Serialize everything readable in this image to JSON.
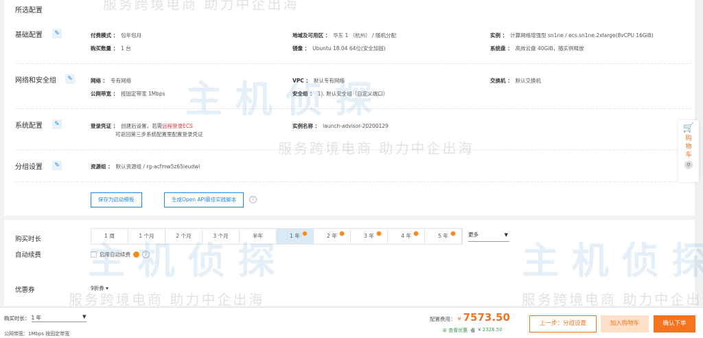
{
  "title": "所选配置",
  "watermark": {
    "logo": "主机侦探",
    "slogan": "服务跨境电商 助力中企出海"
  },
  "sections": {
    "basic": {
      "name": "基础配置",
      "pay_k": "付费模式 ：",
      "pay_v": "包年包月",
      "qty_k": "购买数量 ：",
      "qty_v": "1 台",
      "region_k": "地域及可用区 ：",
      "region_v": "华东 1 （杭州） / 随机分配",
      "image_k": "镜像 ：",
      "image_v": "Ubuntu 18.04 64位(安全加固)",
      "inst_k": "实例 ：",
      "inst_v": "计算网络增强型 sn1ne / ecs.sn1ne.2xlarge(8vCPU 16GiB)",
      "disk_k": "系统盘 ：",
      "disk_v": "高效云盘 40GiB，随实例释放"
    },
    "network": {
      "name": "网络和安全组",
      "net_k": "网络 ：",
      "net_v": "专有网络",
      "bw_k": "公网带宽 ：",
      "bw_v": "按固定带宽 1Mbps",
      "vpc_k": "VPC ：",
      "vpc_v": "默认专有网络",
      "sg_k": "安全组 ：",
      "sg_v": "1). 默认安全组（自定义端口）",
      "sw_k": "交换机 ：",
      "sw_v": "默认交换机"
    },
    "system": {
      "name": "系统配置",
      "login_k": "登录凭证 ：",
      "login_v1": "创建后设置，若需",
      "login_link": "远程登录ECS",
      "login_v2": "可返回第三步系统配置里配置登录凭证",
      "iname_k": "实例名称 ：",
      "iname_v": "launch-advisor-20200129"
    },
    "group": {
      "name": "分组设置",
      "rg_k": "资源组 ：",
      "rg_v": "默认资源组 / rg-acfmw5z65ieudwi"
    }
  },
  "actions": {
    "save_template": "保存为启动模板",
    "gen_openapi": "生成Open API最佳实践脚本",
    "help": "?"
  },
  "purchase": {
    "duration_label": "购买时长",
    "durations": [
      {
        "label": "1 周"
      },
      {
        "label": "1 个月"
      },
      {
        "label": "2 个月"
      },
      {
        "label": "3 个月"
      },
      {
        "label": "半年"
      },
      {
        "label": "1 年",
        "selected": true,
        "discount": true
      },
      {
        "label": "2 年",
        "discount": true
      },
      {
        "label": "3 年",
        "discount": true
      },
      {
        "label": "4 年",
        "discount": true
      },
      {
        "label": "5 年",
        "discount": true
      }
    ],
    "more": "更多",
    "auto_label": "自动续费",
    "auto_checkbox": "启用自动续费",
    "auto_checked": false,
    "coupon_label": "优惠券",
    "coupon_value": "9折券"
  },
  "cart": {
    "label": "购物车",
    "count": "0"
  },
  "footer": {
    "duration_k": "购买时长：",
    "duration_v": "1 年",
    "bw": "公网带宽：1Mbps 按固定带宽",
    "cost_k": "配置费用：",
    "currency": "¥",
    "cost": "7573.50",
    "discount_link": "查看优惠",
    "save_k": "省",
    "save_v": "¥ 2326.50",
    "prev": "上一步：分组设置",
    "add_cart": "加入购物车",
    "confirm": "确认下单"
  },
  "colors": {
    "accent": "#1e88e5",
    "orange": "#f5741f",
    "link_red": "#e4393c"
  }
}
